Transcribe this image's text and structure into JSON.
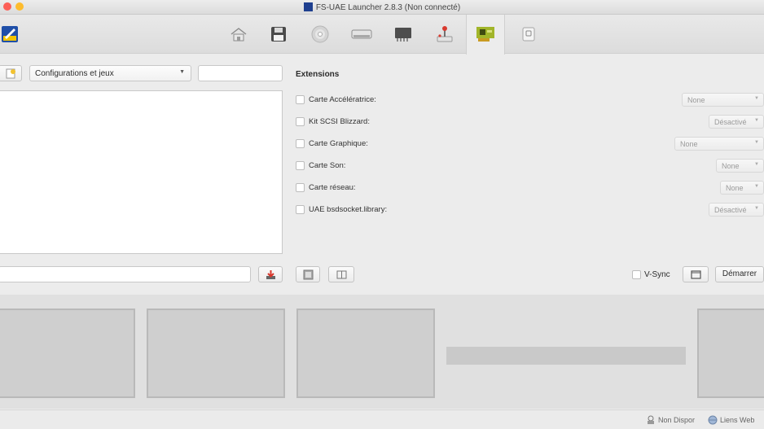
{
  "window": {
    "title": "FS-UAE Launcher 2.8.3 (Non connecté)"
  },
  "colors": {
    "accent_green": "#a2b52a",
    "close_red": "#fc5f57",
    "min_yellow": "#fdbc2e",
    "max_green": "#28c840"
  },
  "toolbar": {
    "icons": [
      "home-icon",
      "floppy-icon",
      "cdrom-icon",
      "harddrive-icon",
      "memory-chip-icon",
      "joystick-icon",
      "expansion-card-icon",
      "device-icon"
    ],
    "active": "expansion-card-icon"
  },
  "left": {
    "config_select_value": "Configurations et jeux",
    "search_value": "",
    "name_value": ""
  },
  "extensions": {
    "heading": "Extensions",
    "rows": [
      {
        "label": "Carte Accélératrice:",
        "value": "None",
        "checked": false
      },
      {
        "label": "Kit SCSI Blizzard:",
        "value": "Désactivé",
        "checked": false
      },
      {
        "label": "Carte Graphique:",
        "value": "None",
        "checked": false
      },
      {
        "label": "Carte Son:",
        "value": "None",
        "checked": false
      },
      {
        "label": "Carte réseau:",
        "value": "None",
        "checked": false
      },
      {
        "label": "UAE bsdsocket.library:",
        "value": "Désactivé",
        "checked": false
      }
    ]
  },
  "controls": {
    "vsync_label": "V-Sync",
    "vsync_checked": false,
    "start_label": "Démarrer"
  },
  "status": {
    "left_label": "Non Dispor",
    "right_label": "Liens Web"
  }
}
